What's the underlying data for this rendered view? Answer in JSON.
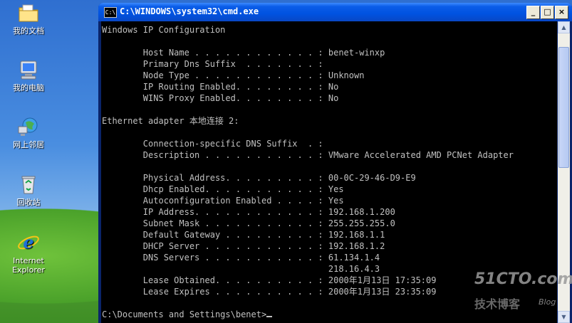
{
  "desktop": {
    "icons": [
      {
        "label": "我的文档",
        "icon": "my-documents-icon"
      },
      {
        "label": "我的电脑",
        "icon": "my-computer-icon"
      },
      {
        "label": "网上邻居",
        "icon": "network-places-icon"
      },
      {
        "label": "回收站",
        "icon": "recycle-bin-icon"
      },
      {
        "label": "Internet Explorer",
        "icon": "internet-explorer-icon"
      }
    ]
  },
  "window": {
    "title": "C:\\WINDOWS\\system32\\cmd.exe",
    "icon_text": "C:\\",
    "minimize_label": "_",
    "maximize_label": "□",
    "close_label": "×"
  },
  "console": {
    "lines": [
      "Windows IP Configuration",
      "",
      "        Host Name . . . . . . . . . . . . : benet-winxp",
      "        Primary Dns Suffix  . . . . . . . :",
      "        Node Type . . . . . . . . . . . . : Unknown",
      "        IP Routing Enabled. . . . . . . . : No",
      "        WINS Proxy Enabled. . . . . . . . : No",
      "",
      "Ethernet adapter 本地连接 2:",
      "",
      "        Connection-specific DNS Suffix  . :",
      "        Description . . . . . . . . . . . : VMware Accelerated AMD PCNet Adapter",
      "",
      "        Physical Address. . . . . . . . . : 00-0C-29-46-D9-E9",
      "        Dhcp Enabled. . . . . . . . . . . : Yes",
      "        Autoconfiguration Enabled . . . . : Yes",
      "        IP Address. . . . . . . . . . . . : 192.168.1.200",
      "        Subnet Mask . . . . . . . . . . . : 255.255.255.0",
      "        Default Gateway . . . . . . . . . : 192.168.1.1",
      "        DHCP Server . . . . . . . . . . . : 192.168.1.2",
      "        DNS Servers . . . . . . . . . . . : 61.134.1.4",
      "                                            218.16.4.3",
      "        Lease Obtained. . . . . . . . . . : 2000年1月13日 17:35:09",
      "        Lease Expires . . . . . . . . . . : 2000年1月13日 23:35:09",
      ""
    ],
    "prompt": "C:\\Documents and Settings\\benet>"
  },
  "scrollbar": {
    "up_arrow": "▲",
    "down_arrow": "▼"
  },
  "watermark": {
    "site": "51CTO.com",
    "tagline": "技术博客",
    "blog": "Blog"
  },
  "colors": {
    "console_bg": "#000000",
    "console_fg": "#c0c0c0",
    "titlebar": "#0052e0"
  }
}
